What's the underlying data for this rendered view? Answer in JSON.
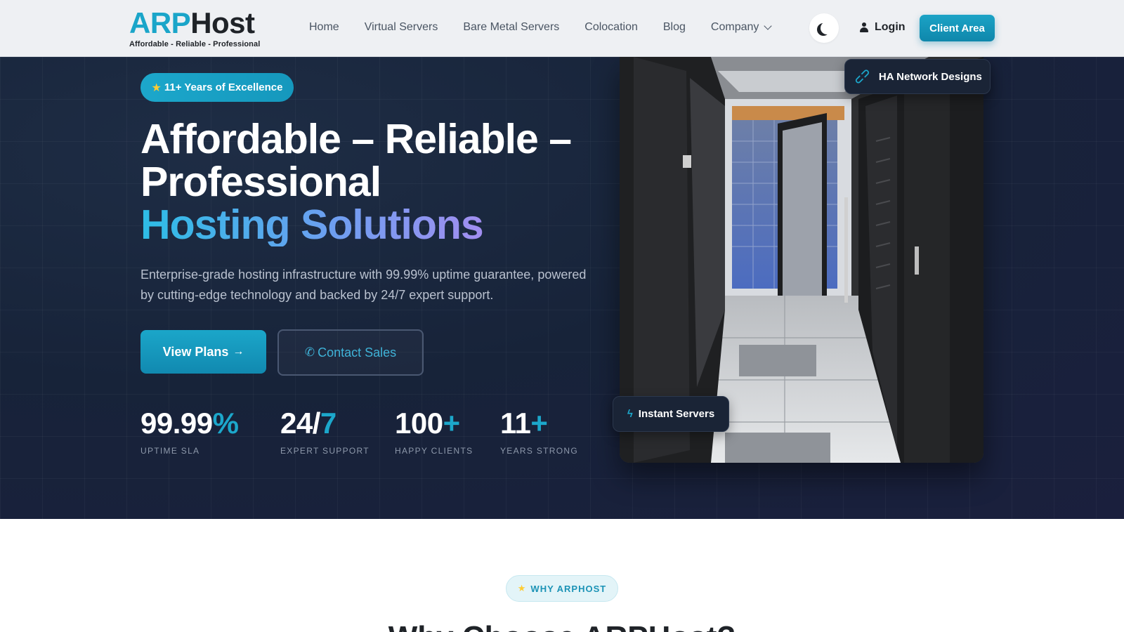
{
  "nav": {
    "logo_brand_accent": "ARP",
    "logo_brand_rest": "Host",
    "logo_tagline": "Affordable - Reliable - Professional",
    "items": [
      {
        "label": "Home"
      },
      {
        "label": "Virtual Servers"
      },
      {
        "label": "Bare Metal Servers"
      },
      {
        "label": "Colocation"
      },
      {
        "label": "Blog"
      },
      {
        "label": "Company",
        "has_dropdown": true
      }
    ],
    "theme_toggle_icon": "moon-icon",
    "login_label": "Login",
    "client_area_label": "Client Area"
  },
  "hero": {
    "badge": "11+ Years of Excellence",
    "title_line1": "Affordable – Reliable –",
    "title_line2": "Professional",
    "title_gradient": "Hosting Solutions",
    "subtitle": "Enterprise-grade hosting infrastructure with 99.99% uptime guarantee, powered by cutting-edge technology and backed by 24/7 expert support.",
    "primary_button": "View Plans",
    "secondary_button": "Contact Sales",
    "stats": [
      {
        "value": "99.99",
        "accent": "%",
        "label": "UPTIME SLA"
      },
      {
        "value": "24/",
        "accent": "7",
        "label": "EXPERT SUPPORT"
      },
      {
        "value": "100",
        "accent": "+",
        "label": "HAPPY CLIENTS"
      },
      {
        "value": "11",
        "accent": "+",
        "label": "YEARS STRONG"
      }
    ],
    "float_tag_top": "HA Network Designs",
    "float_tag_bottom": "Instant Servers"
  },
  "why": {
    "badge": "WHY ARPHOST",
    "title": "Why Choose ARPHost?"
  },
  "colors": {
    "accent": "#1ca7cb",
    "nav_bg": "#eef0f3",
    "hero_bg": "#172339",
    "text_dark": "#1f2328"
  }
}
